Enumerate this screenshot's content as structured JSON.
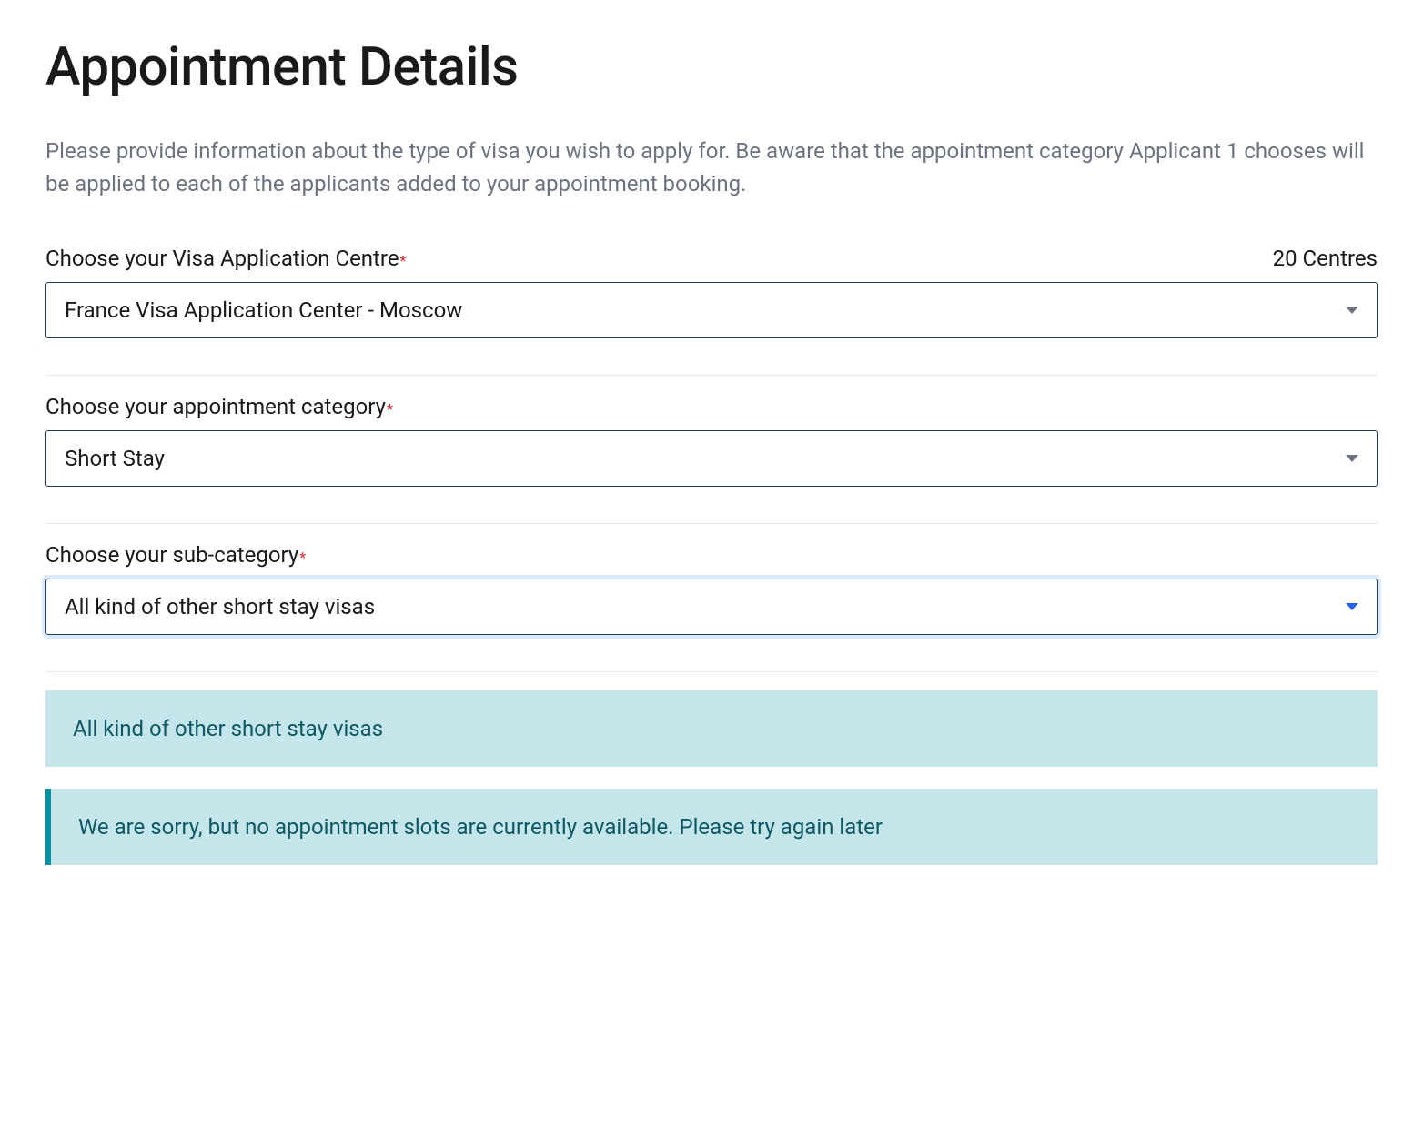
{
  "page": {
    "title": "Appointment Details",
    "intro": "Please provide information about the type of visa you wish to apply for. Be aware that the appointment category Applicant 1 chooses will be applied to each of the applicants added to your appointment booking."
  },
  "fields": {
    "centre": {
      "label": "Choose your Visa Application Centre",
      "required_marker": "*",
      "count": "20 Centres",
      "value": "France Visa Application Center - Moscow"
    },
    "category": {
      "label": "Choose your appointment category",
      "required_marker": "*",
      "value": "Short Stay"
    },
    "subcategory": {
      "label": "Choose your sub-category",
      "required_marker": "*",
      "value": "All kind of other short stay visas"
    }
  },
  "banners": {
    "info_text": "All kind of other short stay visas",
    "alert_text": "We are sorry, but no appointment slots are currently available. Please try again later"
  }
}
